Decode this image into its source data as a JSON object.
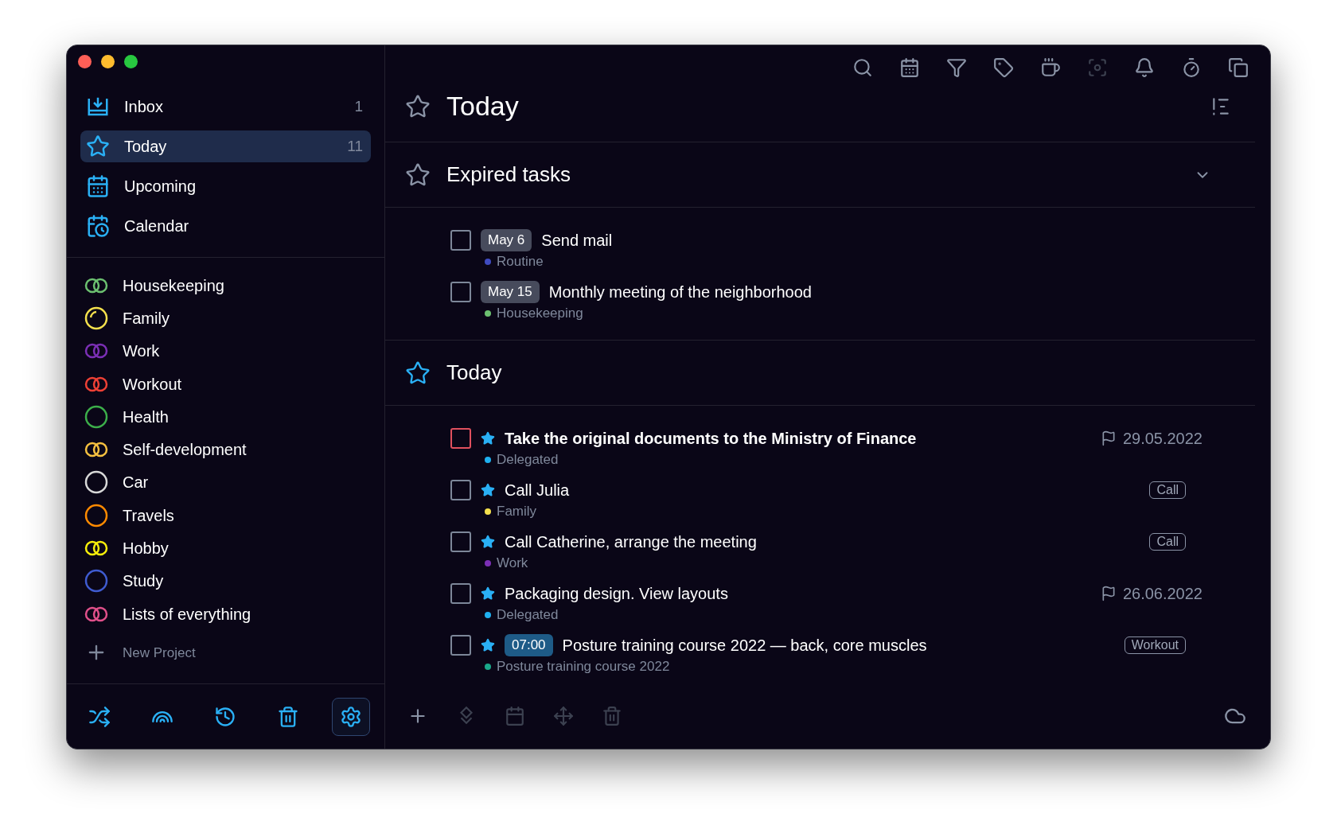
{
  "window": {
    "controls": [
      {
        "color": "#fe5f57"
      },
      {
        "color": "#febc2e"
      },
      {
        "color": "#28c840"
      }
    ]
  },
  "sidebar": {
    "nav": [
      {
        "kind": "inbox",
        "label": "Inbox",
        "count": "1",
        "selected": false
      },
      {
        "kind": "today",
        "label": "Today",
        "count": "11",
        "selected": true
      },
      {
        "kind": "upcoming",
        "label": "Upcoming",
        "selected": false
      },
      {
        "kind": "calendar",
        "label": "Calendar",
        "selected": false
      }
    ],
    "projects": [
      {
        "kind": "double",
        "label": "Housekeeping",
        "color": "#6cc070"
      },
      {
        "kind": "progress",
        "label": "Family",
        "color": "#f4e04d"
      },
      {
        "kind": "double",
        "label": "Work",
        "color": "#7b2fb5"
      },
      {
        "kind": "double",
        "label": "Workout",
        "color": "#ee4035"
      },
      {
        "kind": "ring",
        "label": "Health",
        "color": "#3cae4a"
      },
      {
        "kind": "double",
        "label": "Self-development",
        "color": "#f5c040"
      },
      {
        "kind": "ring",
        "label": "Car",
        "color": "#d8d8d8"
      },
      {
        "kind": "ring",
        "label": "Travels",
        "color": "#ff8a00"
      },
      {
        "kind": "double",
        "label": "Hobby",
        "color": "#f7ee0a"
      },
      {
        "kind": "ring",
        "label": "Study",
        "color": "#3f5bd0"
      },
      {
        "kind": "double",
        "label": "Lists of everything",
        "color": "#e0508a"
      }
    ],
    "new_project": "New Project",
    "toolbar": [
      {
        "kind": "shuffle",
        "selected": false
      },
      {
        "kind": "rainbow",
        "selected": false
      },
      {
        "kind": "history",
        "selected": false
      },
      {
        "kind": "trash",
        "selected": false
      },
      {
        "kind": "settings",
        "selected": true
      }
    ]
  },
  "toolbar": [
    {
      "kind": "search",
      "disabled": false
    },
    {
      "kind": "calendar",
      "disabled": false
    },
    {
      "kind": "filter",
      "disabled": false
    },
    {
      "kind": "tag",
      "disabled": false
    },
    {
      "kind": "coffee",
      "disabled": false
    },
    {
      "kind": "focus",
      "disabled": true
    },
    {
      "kind": "bell",
      "disabled": false
    },
    {
      "kind": "timer",
      "disabled": false
    },
    {
      "kind": "copy",
      "disabled": false
    }
  ],
  "title": "Today",
  "sections": [
    {
      "title": "Expired tasks",
      "highlighted": false,
      "collapsible": true,
      "tasks": [
        {
          "title": "Send mail",
          "important": false,
          "checked": false,
          "badge": {
            "kind": "date",
            "text": "May 6"
          },
          "project": "Routine",
          "color": "#3f4bc0"
        },
        {
          "title": "Monthly meeting of the neighborhood",
          "important": false,
          "checked": false,
          "badge": {
            "kind": "date",
            "text": "May 15"
          },
          "project": "Housekeeping",
          "color": "#6cc070"
        }
      ]
    },
    {
      "title": "Today",
      "highlighted": true,
      "tasks": [
        {
          "title": "Take the original documents to the Ministry of Finance",
          "important": true,
          "checked": false,
          "starred": true,
          "project": "Delegated",
          "color": "#1fb0f0",
          "extra": {
            "kind": "due",
            "text": "29.05.2022"
          }
        },
        {
          "title": "Call Julia",
          "important": false,
          "checked": false,
          "starred": true,
          "project": "Family",
          "color": "#f4e04d",
          "extra": {
            "kind": "tag",
            "text": "Call"
          }
        },
        {
          "title": "Call Catherine, arrange the meeting",
          "important": false,
          "checked": false,
          "starred": true,
          "project": "Work",
          "color": "#7b2fb5",
          "extra": {
            "kind": "tag",
            "text": "Call"
          }
        },
        {
          "title": "Packaging design. View layouts",
          "important": false,
          "checked": false,
          "starred": true,
          "project": "Delegated",
          "color": "#1fb0f0",
          "extra": {
            "kind": "due",
            "text": "26.06.2022"
          }
        },
        {
          "title": "Posture training course 2022 — back, core muscles",
          "important": false,
          "checked": false,
          "starred": true,
          "badge": {
            "kind": "time",
            "text": "07:00"
          },
          "project": "Posture training course 2022",
          "color": "#1aa88a",
          "extra": {
            "kind": "tag",
            "text": "Workout"
          }
        }
      ]
    }
  ],
  "bottom_bar": [
    {
      "kind": "add",
      "disabled": false
    },
    {
      "kind": "diamonds",
      "disabled": true
    },
    {
      "kind": "calendar",
      "disabled": true
    },
    {
      "kind": "move",
      "disabled": true
    },
    {
      "kind": "trash",
      "disabled": true
    }
  ],
  "sync": {
    "kind": "cloud"
  }
}
